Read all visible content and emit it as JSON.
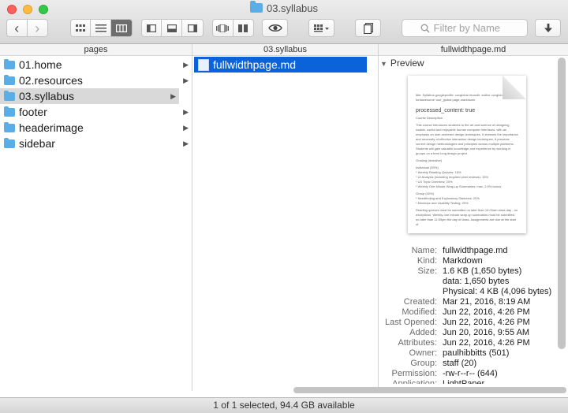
{
  "window": {
    "title": "03.syllabus"
  },
  "toolbar": {
    "back_glyph": "‹",
    "forward_glyph": "›",
    "search_placeholder": "Filter by Name",
    "icons": [
      "chevron-left-icon",
      "chevron-right-icon",
      "icon-view-icon",
      "list-view-icon",
      "column-view-icon",
      "sidebar-left-icon",
      "panel-bottom-icon",
      "sidebar-right-icon",
      "coverflow-icon",
      "split-icon",
      "quicklook-eye-icon",
      "arrange-grid-icon",
      "share-doc-icon",
      "download-icon",
      "search-icon"
    ]
  },
  "columns": {
    "headers": [
      "pages",
      "03.syllabus",
      "fullwidthpage.md"
    ],
    "pages": [
      {
        "label": "01.home"
      },
      {
        "label": "02.resources"
      },
      {
        "label": "03.syllabus"
      },
      {
        "label": "footer"
      },
      {
        "label": "headerimage"
      },
      {
        "label": "sidebar"
      }
    ],
    "syllabus": [
      {
        "label": "fullwidthpage.md"
      }
    ]
  },
  "preview": {
    "heading": "Preview",
    "thumb": {
      "line1": "title: Syllabus googleprofile: cuxglobal revauth: author cuxglobal fontawesome: use_global page-markdown",
      "processed": "processed_content: true",
      "section": "Course Description",
      "para1": "This course introduces students to the art and science of designing usable, useful and enjoyable human computer interfaces, with an emphasis on user-centered design techniques. It stresses the importance and necessity of effective interaction design techniques. It presents current design methodologies and principles across multiple platforms. Students will gain valuable knowledge and experience by working in groups on a term long design project.",
      "grading": "Grading (tentative)",
      "individual": "Individual (50%)",
      "i1": "* Weekly Reading Quizzes: 15%",
      "i2": "* UI Analysis (including required pixel reviews): 15%",
      "i3": "* UX Topic Overview: 20%",
      "i4": "* Weekly One Minute Wrap-up Summaries: max. 2.5% bonus",
      "group": "Group (40%)",
      "g1": "* Needfinding and Exploratory Sketches: 20%",
      "g2": "* Mockups and Usability Testing: 20%",
      "para2": "Reading quizzes must be submitted no later than 10:00am class day - no exceptions. Weekly one minute wrap up summaries must be submitted no later than 11:59pm the day of class. Assignments are due at the start of"
    },
    "info": [
      {
        "k": "Name:",
        "v": "fullwidthpage.md"
      },
      {
        "k": "Kind:",
        "v": "Markdown"
      },
      {
        "k": "Size:",
        "v": "1.6 KB (1,650 bytes)"
      },
      {
        "k": "",
        "v": "data: 1,650 bytes"
      },
      {
        "k": "",
        "v": "Physical: 4 KB (4,096 bytes)"
      },
      {
        "k": "Created:",
        "v": "Mar 21, 2016, 8:19 AM"
      },
      {
        "k": "Modified:",
        "v": "Jun 22, 2016, 4:26 PM"
      },
      {
        "k": "Last Opened:",
        "v": "Jun 22, 2016, 4:26 PM"
      },
      {
        "k": "Added:",
        "v": "Jun 20, 2016, 9:55 AM"
      },
      {
        "k": "Attributes:",
        "v": "Jun 22, 2016, 4:26 PM"
      },
      {
        "k": "Owner:",
        "v": "paulhibbitts (501)"
      },
      {
        "k": "Group:",
        "v": "staff (20)"
      },
      {
        "k": "Permission:",
        "v": "-rw-r--r-- (644)"
      },
      {
        "k": "Application:",
        "v": "LightPaper"
      }
    ]
  },
  "status": {
    "text": "1 of 1 selected, 94.4 GB available"
  },
  "colors": {
    "selection_blue": "#0a63d8",
    "selection_grey": "#d9d9d9",
    "folder_blue": "#5aaee8"
  }
}
